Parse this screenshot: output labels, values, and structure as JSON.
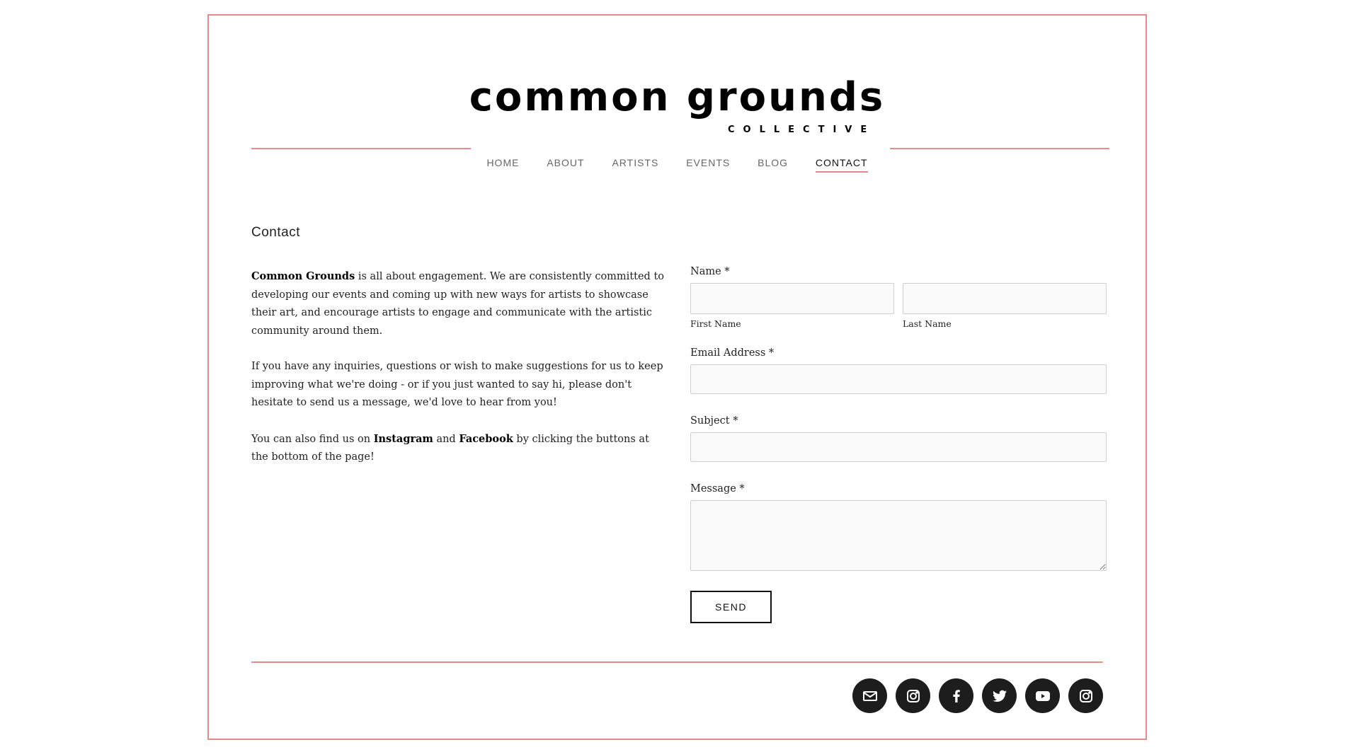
{
  "logo": {
    "main": "common grounds",
    "sub": "COLLECTIVE"
  },
  "nav": {
    "items": [
      "HOME",
      "ABOUT",
      "ARTISTS",
      "EVENTS",
      "BLOG",
      "CONTACT"
    ],
    "active": "CONTACT"
  },
  "page": {
    "title": "Contact"
  },
  "intro": {
    "p1_bold": "Common Grounds",
    "p1_rest": " is all about engagement. We are consistently committed to developing our events and coming up with new ways for artists to showcase their art, and encourage artists to engage and communicate with the artistic community around them.",
    "p2": "If you have any inquiries, questions or wish to make suggestions for us to keep improving what we're doing - or if you just wanted to say hi, please don't hesitate to send us a message, we'd love to hear from you!",
    "p3_a": "You can also find us on ",
    "p3_instagram": "Instagram",
    "p3_and": " and ",
    "p3_facebook": "Facebook",
    "p3_b": " by clicking the buttons at the bottom of the page!"
  },
  "form": {
    "name_label": "Name *",
    "first_name_label": "First Name",
    "last_name_label": "Last Name",
    "first_name_value": "",
    "last_name_value": "",
    "email_label": "Email Address *",
    "email_value": "",
    "subject_label": "Subject *",
    "subject_value": "",
    "message_label": "Message *",
    "message_value": "",
    "send_label": "SEND"
  },
  "social": {
    "icons": [
      "mail-icon",
      "instagram-icon",
      "facebook-icon",
      "twitter-icon",
      "youtube-icon",
      "instagram-icon"
    ]
  },
  "colors": {
    "accent": "#e98a8a",
    "icon_bg": "#1d1d1d",
    "input_bg": "#fafafa"
  }
}
